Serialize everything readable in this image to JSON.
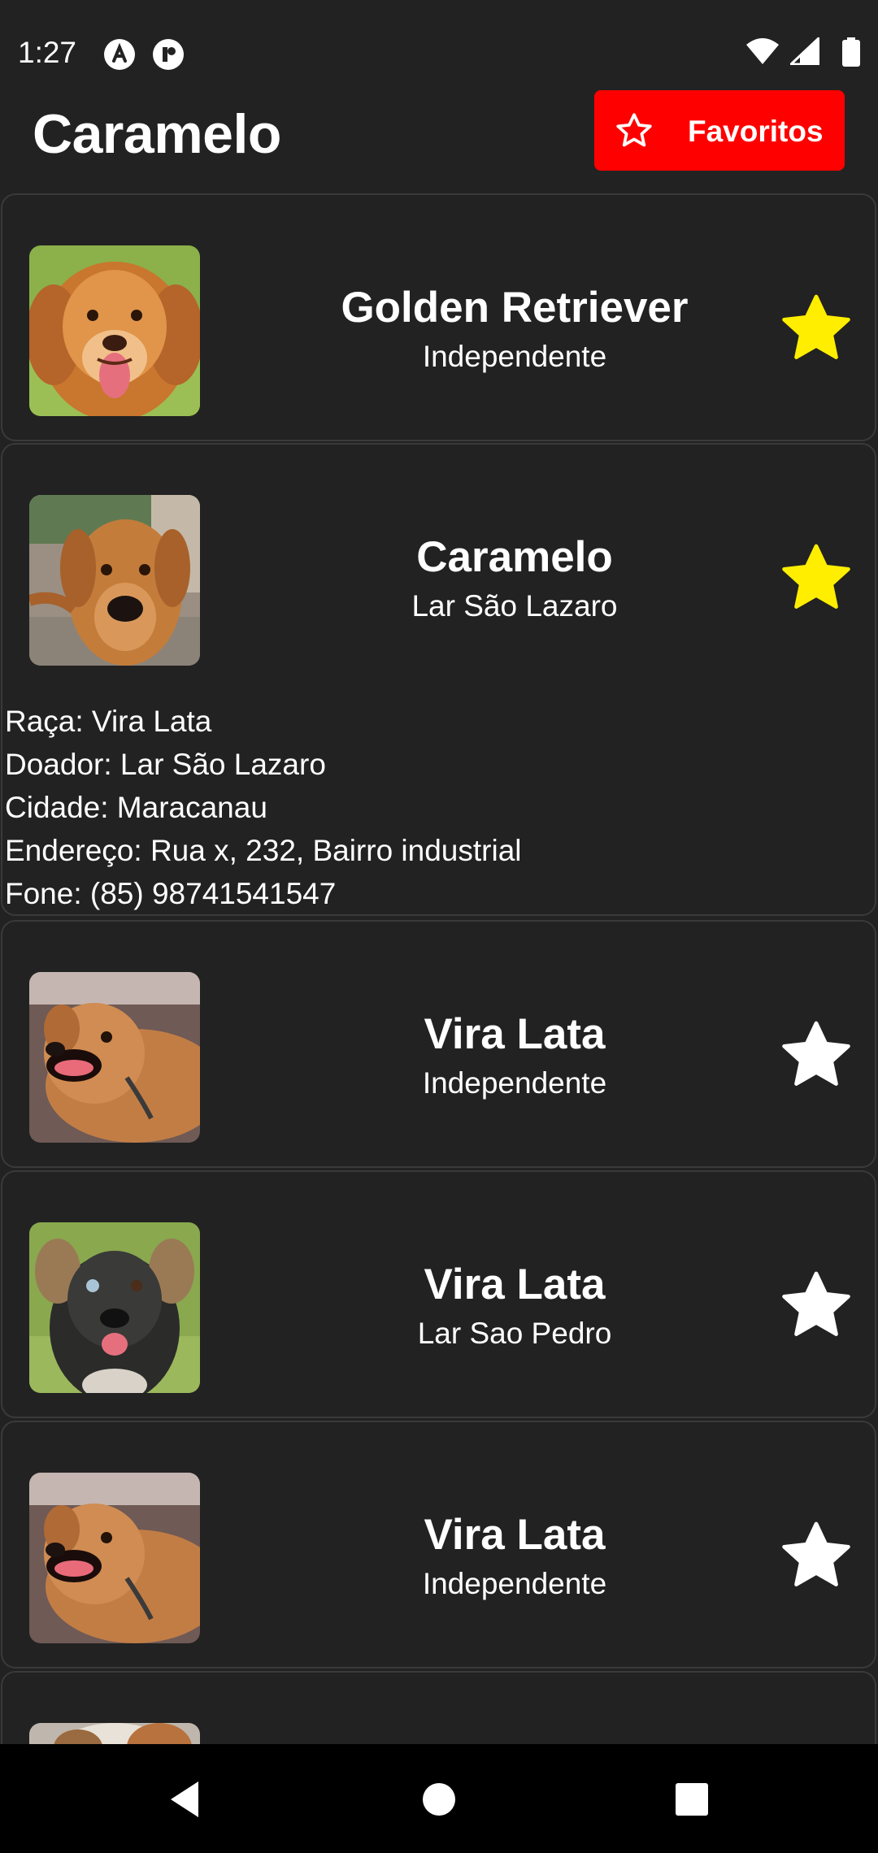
{
  "status_bar": {
    "time": "1:27",
    "icons": [
      "app-notification-icon",
      "app-notification-icon",
      "wifi-icon",
      "cell-signal-icon",
      "battery-icon"
    ]
  },
  "header": {
    "title": "Caramelo",
    "favorites_button_label": "Favoritos",
    "favorites_button_color": "#ff0000"
  },
  "colors": {
    "background": "#222222",
    "favorite_star": "#ffee00",
    "default_star": "#ffffff"
  },
  "dogs": [
    {
      "name": "Golden Retriever",
      "donor": "Independente",
      "favorite": true,
      "photo": "golden-retriever-photo"
    },
    {
      "name": "Caramelo",
      "donor": "Lar São Lazaro",
      "favorite": true,
      "photo": "caramelo-dog-photo",
      "details": {
        "breed": "Raça: Vira Lata",
        "donor": "Doador: Lar São Lazaro",
        "city": "Cidade: Maracanau",
        "address": "Endereço: Rua x, 232, Bairro industrial",
        "phone": "Fone: (85) 98741541547"
      }
    },
    {
      "name": "Vira Lata",
      "donor": "Independente",
      "favorite": false,
      "photo": "vira-lata-photo"
    },
    {
      "name": "Vira Lata",
      "donor": "Lar Sao Pedro",
      "favorite": false,
      "photo": "black-puppy-photo"
    },
    {
      "name": "Vira Lata",
      "donor": "Independente",
      "favorite": false,
      "photo": "vira-lata-photo"
    }
  ],
  "nav_bar": {
    "buttons": [
      "back-icon",
      "home-icon",
      "recents-icon"
    ]
  }
}
